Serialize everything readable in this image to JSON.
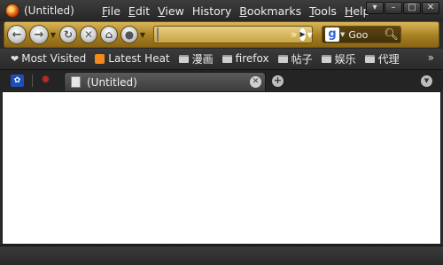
{
  "window": {
    "title": "(Untitled)",
    "controls": [
      "▾",
      "–",
      "□",
      "✕"
    ]
  },
  "menu": [
    {
      "accesskey": "F",
      "rest": "ile"
    },
    {
      "accesskey": "E",
      "rest": "dit"
    },
    {
      "accesskey": "V",
      "rest": "iew"
    },
    {
      "accesskey": "",
      "label": "History"
    },
    {
      "accesskey": "B",
      "rest": "ookmarks"
    },
    {
      "accesskey": "T",
      "rest": "ools"
    },
    {
      "accesskey": "H",
      "rest": "elp"
    }
  ],
  "navbar": {
    "url_value": "",
    "search_value": "Goo"
  },
  "bookmarks": {
    "items": [
      {
        "label": "Most Visited",
        "icon": "heart-icon"
      },
      {
        "label": "Latest Heat",
        "icon": "rss-icon"
      },
      {
        "label": "漫画",
        "icon": "folder-icon"
      },
      {
        "label": "firefox",
        "icon": "folder-icon"
      },
      {
        "label": "帖子",
        "icon": "folder-icon"
      },
      {
        "label": "娱乐",
        "icon": "folder-icon"
      },
      {
        "label": "代理",
        "icon": "folder-icon"
      }
    ],
    "more": "»"
  },
  "tabs": {
    "active_label": "(Untitled)"
  },
  "colors": {
    "accent_gold": "#c9a441",
    "chrome_dark": "#2b2b2b",
    "content_bg": "#ffffff"
  }
}
